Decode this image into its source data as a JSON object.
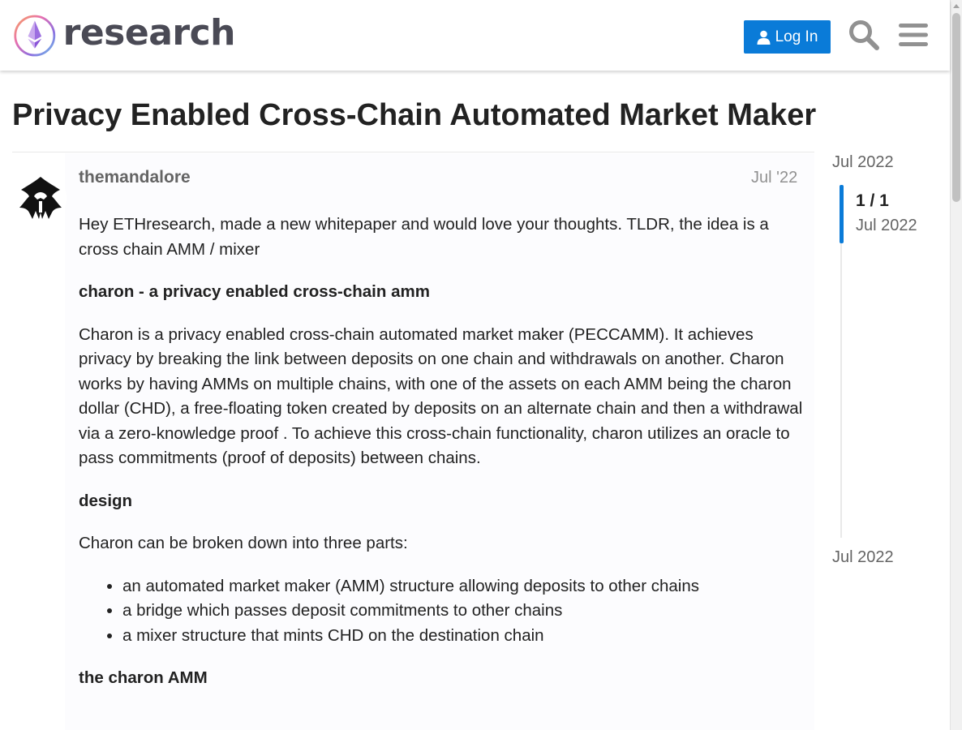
{
  "header": {
    "logo_text": "research",
    "login_label": "Log In",
    "icons": [
      "search-icon",
      "hamburger-menu-icon",
      "user-icon"
    ]
  },
  "topic": {
    "title": "Privacy Enabled Cross-Chain Automated Market Maker"
  },
  "post": {
    "username": "themandalore",
    "date": "Jul '22",
    "paragraphs": {
      "intro": "Hey ETHresearch, made a new whitepaper and would love your thoughts. TLDR, the idea is a cross chain AMM / mixer",
      "heading1": "charon - a privacy enabled cross-chain amm",
      "body1": "Charon is a privacy enabled cross-chain automated market maker (PECCAMM). It achieves privacy by breaking the link between deposits on one chain and withdrawals on another. Charon works by having AMMs on multiple chains, with one of the assets on each AMM being the charon dollar (CHD), a free-floating token created by deposits on an alternate chain and then a withdrawal via a zero-knowledge proof . To achieve this cross-chain functionality, charon utilizes an oracle to pass commitments (proof of deposits) between chains.",
      "heading2": "design",
      "body2": "Charon can be broken down into three parts:",
      "heading3": "the charon AMM"
    },
    "list": [
      "an automated market maker (AMM) structure allowing deposits to other chains",
      "a bridge which passes deposit commitments to other chains",
      "a mixer structure that mints CHD on the destination chain"
    ]
  },
  "timeline": {
    "top_date": "Jul 2022",
    "count": "1 / 1",
    "count_date": "Jul 2022",
    "bottom_date": "Jul 2022"
  },
  "colors": {
    "accent": "#0a7bd8",
    "text": "#222222",
    "muted": "#646464"
  }
}
